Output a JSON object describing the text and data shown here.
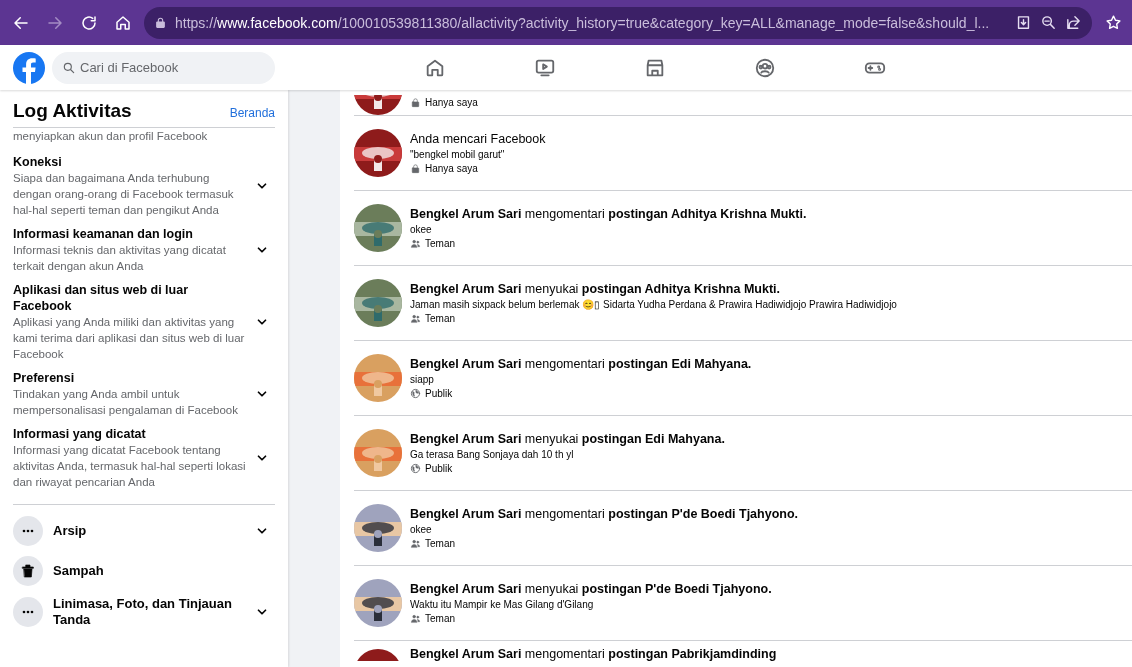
{
  "browser": {
    "back_enabled": true,
    "forward_enabled": false,
    "url": "https://**www.facebook.com**/100010539811380/allactivity?activity_history=true&category_key=ALL&manage_mode=false&should_l..."
  },
  "header": {
    "search": {
      "placeholder": "Cari di Facebook"
    },
    "nav": [
      {
        "kind": "home"
      },
      {
        "kind": "video"
      },
      {
        "kind": "store"
      },
      {
        "kind": "groups"
      },
      {
        "kind": "gaming"
      }
    ]
  },
  "sidebar": {
    "title": "Log Aktivitas",
    "home_link": "Beranda",
    "scrolled_text": "menyiapkan akun dan profil Facebook",
    "sections": [
      {
        "title": "Koneksi",
        "description": "Siapa dan bagaimana Anda terhubung dengan orang-orang di Facebook termasuk hal-hal seperti teman dan pengikut Anda",
        "expanded": false
      },
      {
        "title": "Informasi keamanan dan login",
        "description": "Informasi teknis dan aktivitas yang dicatat terkait dengan akun Anda",
        "expanded": false
      },
      {
        "title": "Aplikasi dan situs web di luar Facebook",
        "description": "Aplikasi yang Anda miliki dan aktivitas yang kami terima dari aplikasi dan situs web di luar Facebook",
        "expanded": false
      },
      {
        "title": "Preferensi",
        "description": "Tindakan yang Anda ambil untuk mempersonalisasi pengalaman di Facebook",
        "expanded": false
      },
      {
        "title": "Informasi yang dicatat",
        "description": "Informasi yang dicatat Facebook tentang aktivitas Anda, termasuk hal-hal seperti lokasi dan riwayat pencarian Anda",
        "expanded": false
      }
    ],
    "items": [
      {
        "kind": "expandable",
        "label": "Arsip"
      },
      {
        "kind": "link",
        "label": "Sampah"
      },
      {
        "kind": "expandable",
        "label": "Linimasa, Foto, dan Tinjauan Tanda"
      }
    ]
  },
  "activities": [
    {
      "kind": "partial",
      "privacy": {
        "kind": "only_me",
        "label": "Hanya saya"
      }
    },
    {
      "kind": "full",
      "title": "Anda mencari Facebook",
      "detail": "\"bengkel mobil garut\"",
      "privacy": {
        "kind": "only_me",
        "label": "Hanya saya"
      }
    },
    {
      "kind": "full",
      "title": "**Bengkel Arum Sari** mengomentari **postingan Adhitya Krishna Mukti.**",
      "detail": "okee",
      "privacy": {
        "kind": "friends",
        "label": "Teman"
      }
    },
    {
      "kind": "full",
      "title": "**Bengkel Arum Sari** menyukai **postingan Adhitya Krishna Mukti.**",
      "detail": "Jaman masih sixpack belum berlemak 😊▯ Sidarta Yudha Perdana & Prawira Hadiwidjojo Prawira Hadiwidjojo",
      "privacy": {
        "kind": "friends",
        "label": "Teman"
      }
    },
    {
      "kind": "full",
      "title": "**Bengkel Arum Sari** mengomentari **postingan Edi Mahyana.**",
      "detail": "siapp",
      "privacy": {
        "kind": "public",
        "label": "Publik"
      }
    },
    {
      "kind": "full",
      "title": "**Bengkel Arum Sari** menyukai **postingan Edi Mahyana.**",
      "detail": "Ga terasa Bang Sonjaya dah 10 th yl",
      "privacy": {
        "kind": "public",
        "label": "Publik"
      }
    },
    {
      "kind": "full",
      "title": "**Bengkel Arum Sari** mengomentari **postingan P'de Boedi Tjahyono.**",
      "detail": "okee",
      "privacy": {
        "kind": "friends",
        "label": "Teman"
      }
    },
    {
      "kind": "full",
      "title": "**Bengkel Arum Sari** menyukai **postingan P'de Boedi Tjahyono.**",
      "detail": "Waktu itu Mampir ke Mas Gilang d'Gilang",
      "privacy": {
        "kind": "friends",
        "label": "Teman"
      }
    },
    {
      "kind": "cut",
      "title": "**Bengkel Arum Sari** mengomentari **postingan Pabrikjamdinding**"
    }
  ]
}
